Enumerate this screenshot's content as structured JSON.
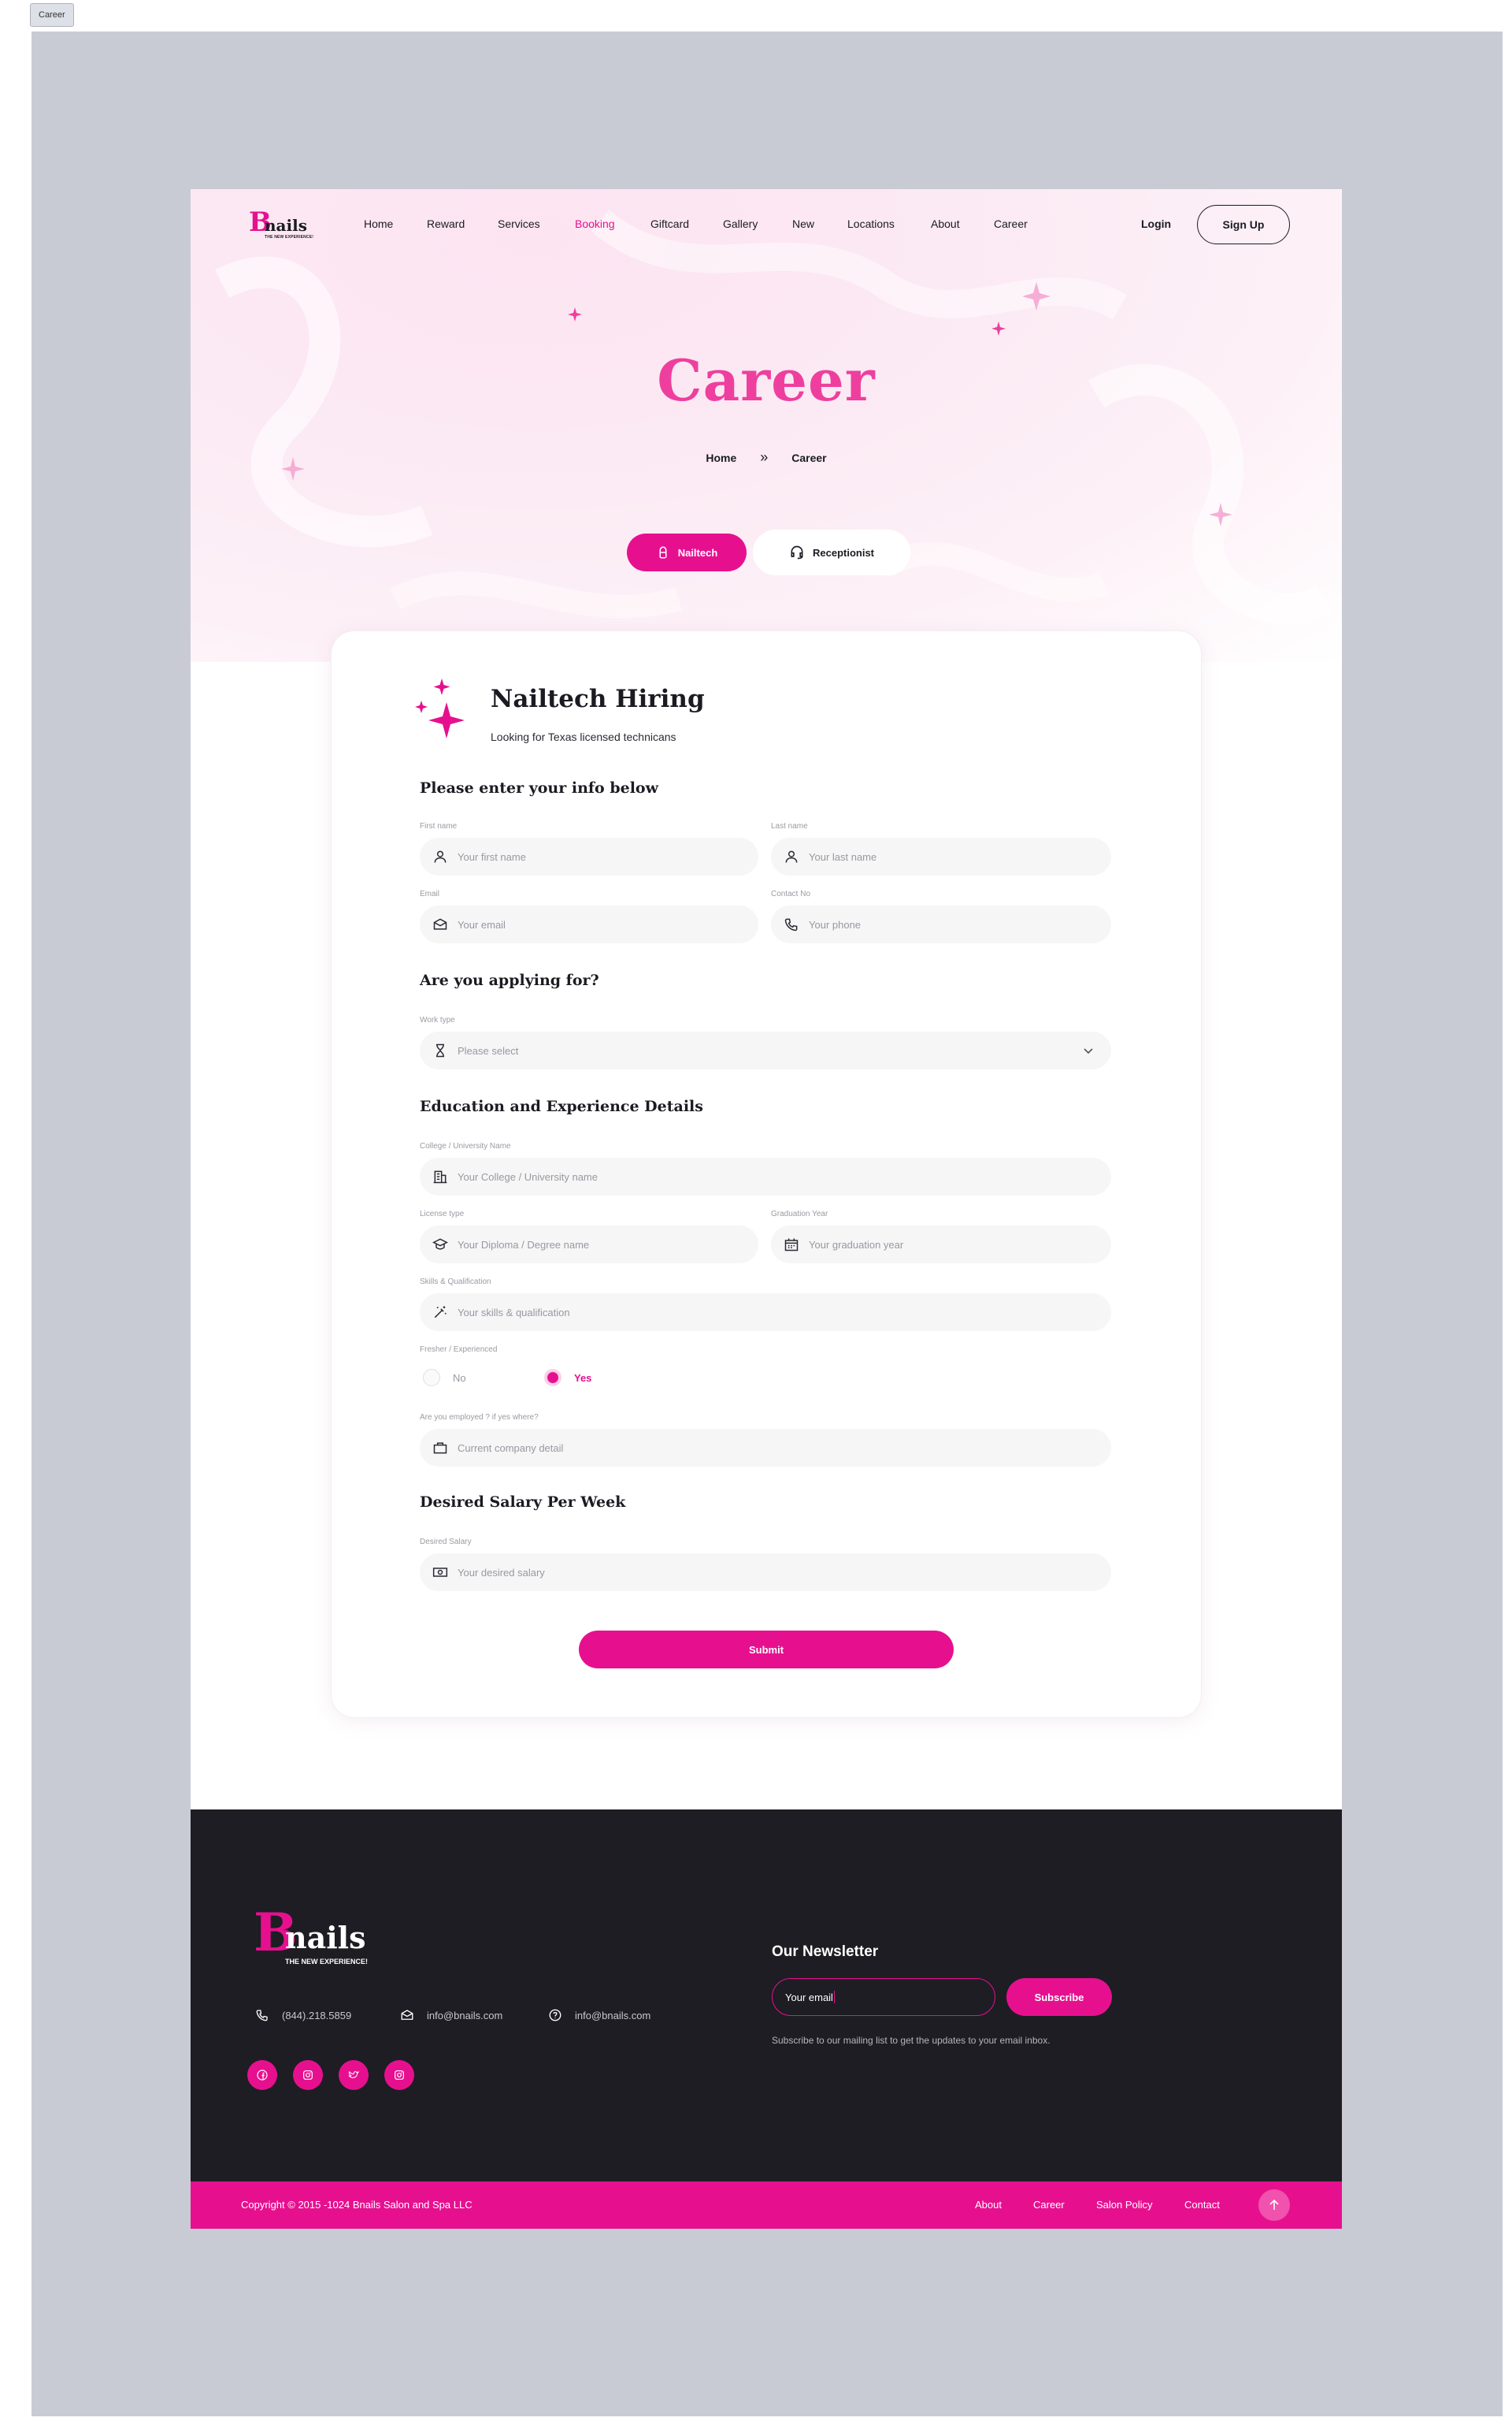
{
  "frame": {
    "label": "Career"
  },
  "brand": {
    "name": "nails",
    "initial": "B",
    "tagline": "THE NEW EXPERIENCE!",
    "accent": "#e6108f",
    "title_pink": "#ee3f9e",
    "footer_bg": "#1d1d23"
  },
  "nav": {
    "items": [
      "Home",
      "Reward",
      "Services",
      "Booking",
      "Giftcard",
      "Gallery",
      "New",
      "Locations",
      "About",
      "Career"
    ],
    "active": "Booking",
    "login": "Login",
    "signup": "Sign Up"
  },
  "hero": {
    "title": "Career",
    "breadcrumb": {
      "home": "Home",
      "current": "Career"
    }
  },
  "tabs": [
    {
      "label": "Nailtech",
      "icon": "nail-icon",
      "active": true
    },
    {
      "label": "Receptionist",
      "icon": "headset-icon",
      "active": false
    }
  ],
  "form": {
    "title": "Nailtech Hiring",
    "subtitle": "Looking for Texas licensed technicans",
    "sections": {
      "info": "Please enter your info below",
      "applying": "Are you applying for?",
      "education": "Education and Experience Details",
      "salary": "Desired Salary Per Week"
    },
    "fields": {
      "first_name": {
        "label": "First name",
        "placeholder": "Your first name",
        "icon": "user-icon"
      },
      "last_name": {
        "label": "Last name",
        "placeholder": "Your last name",
        "icon": "user-icon"
      },
      "email": {
        "label": "Email",
        "placeholder": "Your email",
        "icon": "envelope-icon"
      },
      "contact": {
        "label": "Contact No",
        "placeholder": "Your phone",
        "icon": "phone-icon"
      },
      "work_type": {
        "label": "Work type",
        "placeholder": "Please select",
        "icon": "hourglass-icon"
      },
      "college": {
        "label": "College / University Name",
        "placeholder": "Your College / University name",
        "icon": "building-icon"
      },
      "license": {
        "label": "License type",
        "placeholder": "Your Diploma / Degree name",
        "icon": "graduation-cap-icon"
      },
      "grad_year": {
        "label": "Graduation Year",
        "placeholder": "Your graduation year",
        "icon": "calendar-icon"
      },
      "skills": {
        "label": "Skills & Qualification",
        "placeholder": "Your skills & qualification",
        "icon": "magic-wand-icon"
      },
      "experience": {
        "label": "Fresher / Experienced",
        "options": [
          "No",
          "Yes"
        ],
        "selected": "Yes"
      },
      "employed": {
        "label": "Are you employed ? if yes where?",
        "placeholder": "Current company detail",
        "icon": "briefcase-icon"
      },
      "salary": {
        "label": "Desired Salary",
        "placeholder": "Your desired salary",
        "icon": "money-icon"
      }
    },
    "submit": "Submit"
  },
  "footer": {
    "phone": "(844).218.5859",
    "email": "info@bnails.com",
    "support": "info@bnails.com",
    "socials": [
      "facebook-icon",
      "instagram-icon",
      "twitter-icon",
      "instagram-icon"
    ],
    "newsletter": {
      "title": "Our Newsletter",
      "input_value": "Your email",
      "button": "Subscribe",
      "note": "Subscribe to our mailing list to get the updates to your email inbox."
    },
    "copyright": "Copyright © 2015 -1024 Bnails Salon and Spa LLC",
    "links": [
      "About",
      "Career",
      "Salon Policy",
      "Contact"
    ]
  }
}
